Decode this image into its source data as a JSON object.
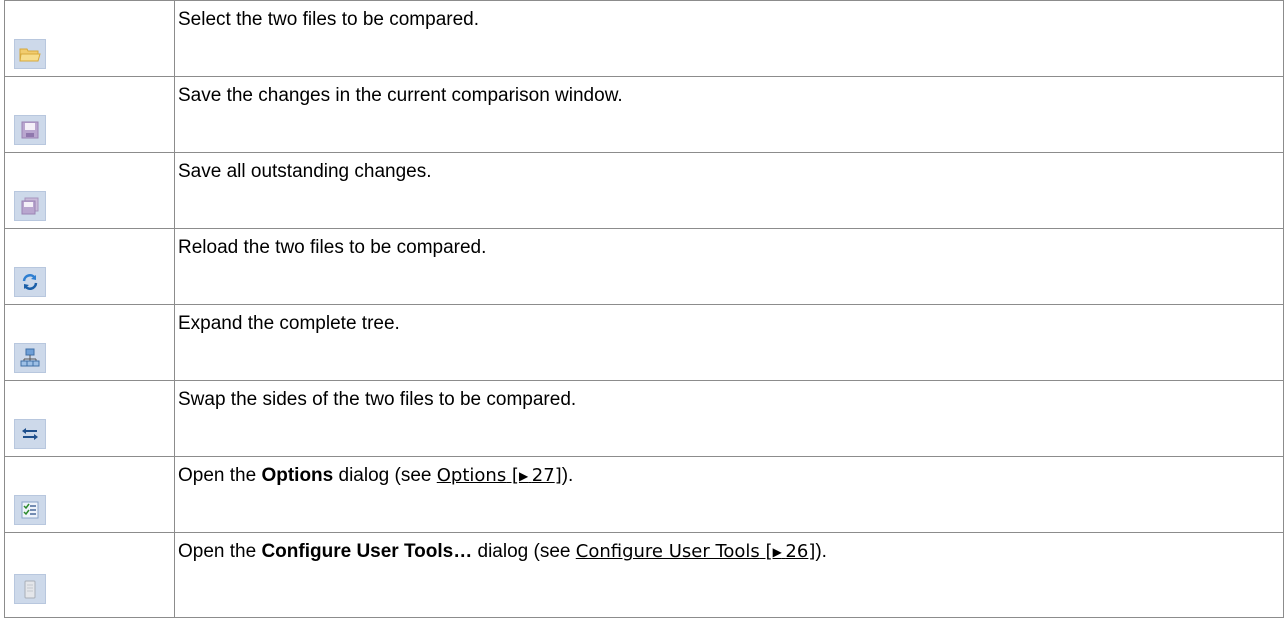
{
  "rows": [
    {
      "icon": "open-folder-icon",
      "text": "Select the two files to be compared."
    },
    {
      "icon": "save-icon",
      "text": "Save the changes in the current comparison window."
    },
    {
      "icon": "save-all-icon",
      "text": "Save all outstanding changes."
    },
    {
      "icon": "reload-icon",
      "text": "Reload the two files to be compared."
    },
    {
      "icon": "expand-tree-icon",
      "text": "Expand the complete tree."
    },
    {
      "icon": "swap-sides-icon",
      "text": "Swap the sides of the two files to be compared."
    },
    {
      "icon": "options-icon",
      "pre": "Open the ",
      "bold": "Options",
      "mid": " dialog (see ",
      "link_text": "Options",
      "link_page": "27",
      "post": ")."
    },
    {
      "icon": "user-tools-icon",
      "pre": "Open the ",
      "bold": "Configure User Tools…",
      "mid": " dialog (see ",
      "link_text": "Configure User Tools",
      "link_page": "26",
      "post": ")."
    }
  ],
  "colors": {
    "border": "#8c8c8c",
    "icon_bg": "#cdd9ea"
  }
}
